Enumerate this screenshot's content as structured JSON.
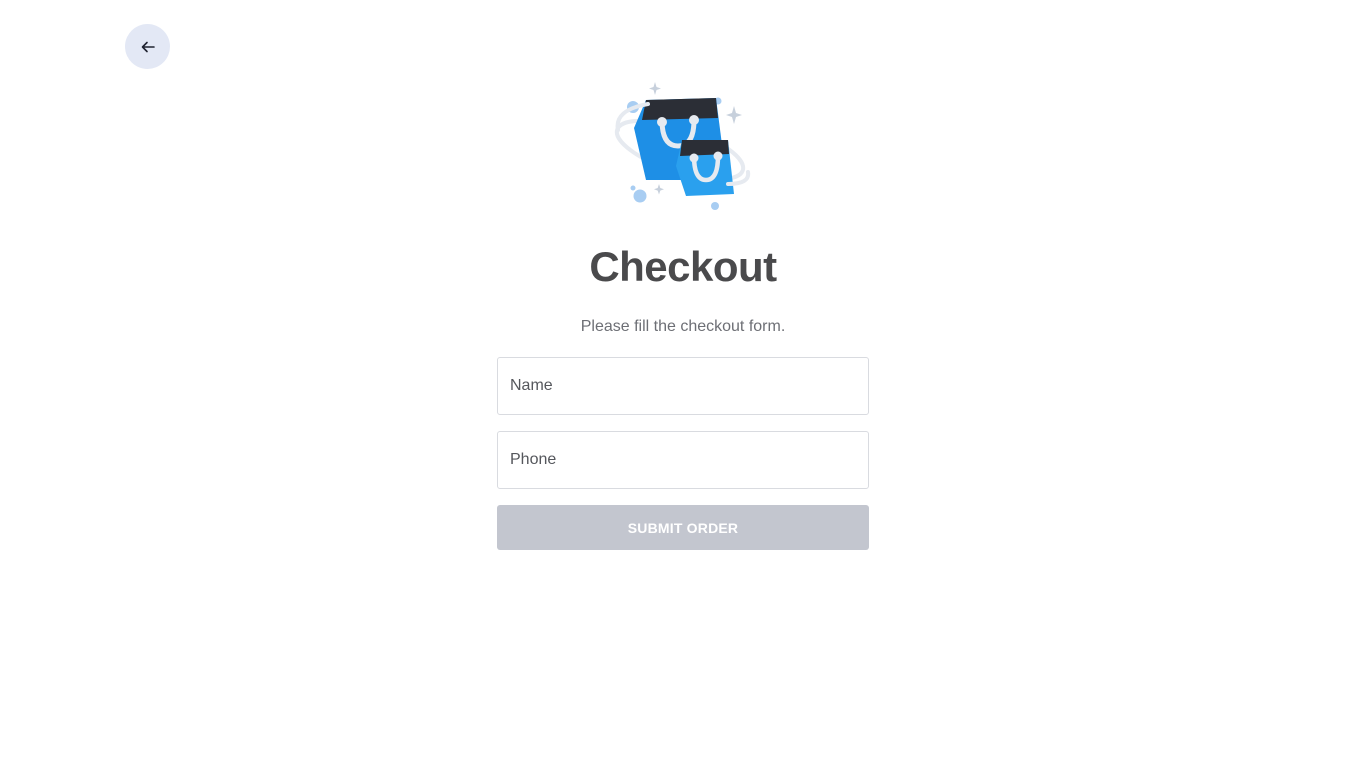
{
  "nav": {
    "back_icon": "arrow-left-icon"
  },
  "hero": {
    "icon": "shopping-bags-icon",
    "colors": {
      "bag": "#1e8fe6",
      "bag_top": "#2b2e36",
      "handle": "#e6eaf0",
      "sparkle": "#c7d0dc"
    }
  },
  "checkout": {
    "title": "Checkout",
    "subtitle": "Please fill the checkout form.",
    "name_placeholder": "Name",
    "phone_placeholder": "Phone",
    "submit_label": "SUBMIT ORDER"
  },
  "colors": {
    "back_button_bg": "#e3e8f5",
    "submit_disabled_bg": "#c3c6cf",
    "title_text": "#4a4a4c"
  }
}
